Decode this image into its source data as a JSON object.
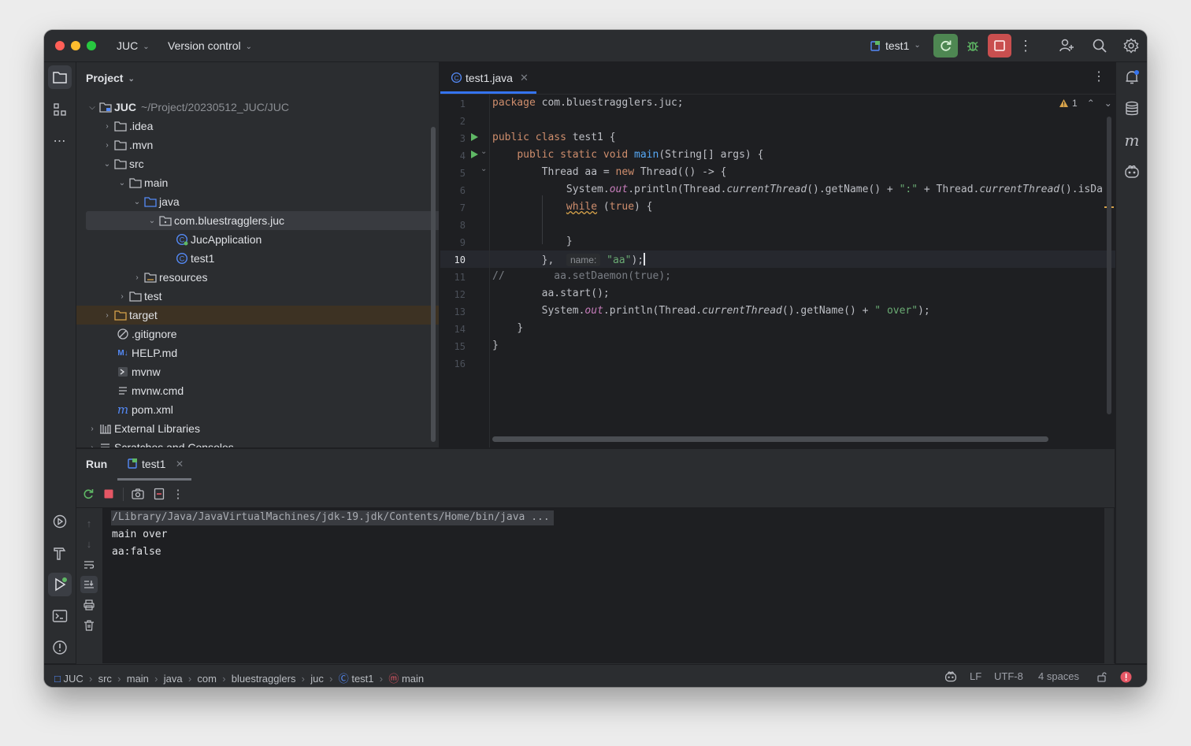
{
  "titlebar": {
    "project_name": "JUC",
    "vcs_label": "Version control",
    "run_config": "test1"
  },
  "project_panel": {
    "title": "Project",
    "root_name": "JUC",
    "root_path": "~/Project/20230512_JUC/JUC",
    "items": [
      {
        "label": ".idea"
      },
      {
        "label": ".mvn"
      },
      {
        "label": "src"
      },
      {
        "label": "main"
      },
      {
        "label": "java"
      },
      {
        "label": "com.bluestragglers.juc"
      },
      {
        "label": "JucApplication"
      },
      {
        "label": "test1"
      },
      {
        "label": "resources"
      },
      {
        "label": "test"
      },
      {
        "label": "target"
      },
      {
        "label": ".gitignore"
      },
      {
        "label": "HELP.md"
      },
      {
        "label": "mvnw"
      },
      {
        "label": "mvnw.cmd"
      },
      {
        "label": "pom.xml"
      },
      {
        "label": "External Libraries"
      },
      {
        "label": "Scratches and Consoles"
      }
    ]
  },
  "editor": {
    "tab_label": "test1.java",
    "warning_count": "1",
    "line_numbers": [
      "1",
      "2",
      "3",
      "4",
      "5",
      "6",
      "7",
      "8",
      "9",
      "10",
      "11",
      "12",
      "13",
      "14",
      "15",
      "16"
    ],
    "current_line": "10",
    "code": {
      "l1_kw": "package",
      "l1_rest": " com.bluestragglers.juc;",
      "l3_kw": "public class",
      "l3_rest": " test1 {",
      "l4_kw": "public static void",
      "l4_fn": "main",
      "l4_rest": "(String[] args) {",
      "l5_a": "Thread aa = ",
      "l5_kw": "new",
      "l5_b": " Thread(() -> {",
      "l6_a": "System.",
      "l6_out": "out",
      "l6_b": ".println(Thread.",
      "l6_ct": "currentThread",
      "l6_c": "().getName() + ",
      "l6_str": "\":\"",
      "l6_d": " + Thread.",
      "l6_ct2": "currentThread",
      "l6_e": "().isDa",
      "l7_kw": "while",
      "l7_a": " (",
      "l7_true": "true",
      "l7_b": ") {",
      "l9": "}",
      "l10_a": "},",
      "l10_hint": "name:",
      "l10_str": "\"aa\"",
      "l10_b": ");",
      "l11_cm": "//",
      "l11_code": "aa.setDaemon(true);",
      "l12": "aa.start();",
      "l13_a": "System.",
      "l13_out": "out",
      "l13_b": ".println(Thread.",
      "l13_ct": "currentThread",
      "l13_c": "().getName() + ",
      "l13_str": "\" over\"",
      "l13_d": ");",
      "l14": "}",
      "l15": "}"
    }
  },
  "run_panel": {
    "title": "Run",
    "tab_label": "test1",
    "console_lines": [
      "/Library/Java/JavaVirtualMachines/jdk-19.jdk/Contents/Home/bin/java ...",
      "main over",
      "aa:false"
    ]
  },
  "statusbar": {
    "breadcrumbs": [
      "JUC",
      "src",
      "main",
      "java",
      "com",
      "bluestragglers",
      "juc",
      "test1",
      "main"
    ],
    "line_ending": "LF",
    "encoding": "UTF-8",
    "indent": "4 spaces"
  },
  "colors": {
    "accent_blue": "#3574f0",
    "run_green": "#5fb865",
    "stop_red": "#e55765",
    "keyword": "#cf8e6d",
    "string": "#6aab73",
    "function": "#56a8f5"
  }
}
